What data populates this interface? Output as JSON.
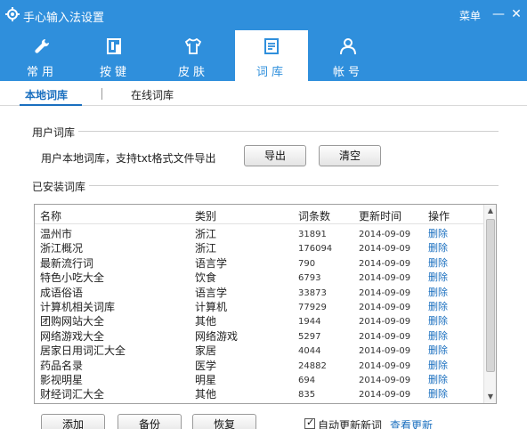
{
  "window": {
    "title": "手心输入法设置",
    "menu_label": "菜单",
    "minimize_glyph": "—",
    "close_glyph": "✕"
  },
  "tabs": [
    {
      "label": "常用",
      "icon": "wrench-icon",
      "active": false
    },
    {
      "label": "按键",
      "icon": "key-icon",
      "active": false
    },
    {
      "label": "皮肤",
      "icon": "shirt-icon",
      "active": false
    },
    {
      "label": "词库",
      "icon": "document-icon",
      "active": true
    },
    {
      "label": "帐号",
      "icon": "user-icon",
      "active": false
    }
  ],
  "subtabs": [
    {
      "label": "本地词库",
      "active": true
    },
    {
      "label": "在线词库",
      "active": false
    }
  ],
  "user_dict": {
    "title": "用户词库",
    "description": "用户本地词库，支持txt格式文件导出",
    "export_label": "导出",
    "clear_label": "清空"
  },
  "installed": {
    "title": "已安装词库",
    "columns": [
      "名称",
      "类别",
      "词条数",
      "更新时间",
      "操作"
    ],
    "rows": [
      {
        "name": "温州市",
        "category": "浙江",
        "count": "31891",
        "date": "2014-09-09",
        "action": "删除"
      },
      {
        "name": "浙江概况",
        "category": "浙江",
        "count": "176094",
        "date": "2014-09-09",
        "action": "删除"
      },
      {
        "name": "最新流行词",
        "category": "语言学",
        "count": "790",
        "date": "2014-09-09",
        "action": "删除"
      },
      {
        "name": "特色小吃大全",
        "category": "饮食",
        "count": "6793",
        "date": "2014-09-09",
        "action": "删除"
      },
      {
        "name": "成语俗语",
        "category": "语言学",
        "count": "33873",
        "date": "2014-09-09",
        "action": "删除"
      },
      {
        "name": "计算机相关词库",
        "category": "计算机",
        "count": "77929",
        "date": "2014-09-09",
        "action": "删除"
      },
      {
        "name": "团购网站大全",
        "category": "其他",
        "count": "1944",
        "date": "2014-09-09",
        "action": "删除"
      },
      {
        "name": "网络游戏大全",
        "category": "网络游戏",
        "count": "5297",
        "date": "2014-09-09",
        "action": "删除"
      },
      {
        "name": "居家日用词汇大全",
        "category": "家居",
        "count": "4044",
        "date": "2014-09-09",
        "action": "删除"
      },
      {
        "name": "药品名录",
        "category": "医学",
        "count": "24882",
        "date": "2014-09-09",
        "action": "删除"
      },
      {
        "name": "影视明星",
        "category": "明星",
        "count": "694",
        "date": "2014-09-09",
        "action": "删除"
      },
      {
        "name": "财经词汇大全",
        "category": "其他",
        "count": "835",
        "date": "2014-09-09",
        "action": "删除"
      }
    ]
  },
  "bottom": {
    "add_label": "添加",
    "backup_label": "备份",
    "restore_label": "恢复",
    "auto_update_label": "自动更新新词",
    "auto_update_checked": true,
    "check_update_link": "查看更新"
  },
  "colors": {
    "accent": "#2f8fdc",
    "link": "#1a6fbf"
  }
}
